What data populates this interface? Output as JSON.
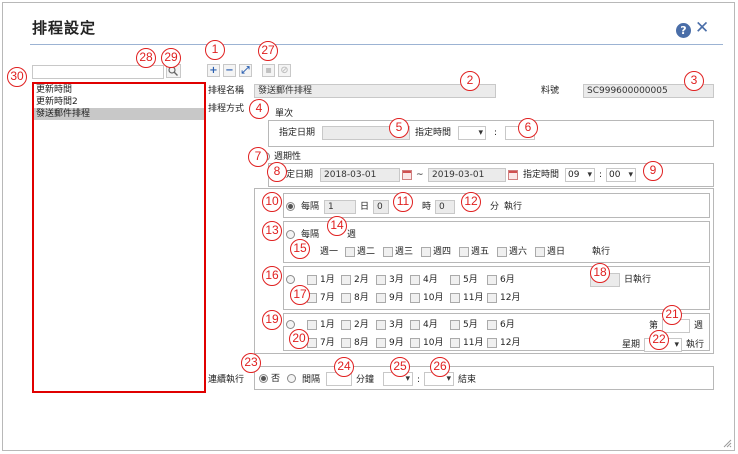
{
  "dialog": {
    "title": "排程設定",
    "help_icon": "?",
    "close_icon": "✕"
  },
  "markers": [
    "1",
    "2",
    "3",
    "4",
    "5",
    "6",
    "7",
    "8",
    "9",
    "10",
    "11",
    "12",
    "13",
    "14",
    "15",
    "16",
    "17",
    "18",
    "19",
    "20",
    "21",
    "22",
    "23",
    "24",
    "25",
    "26",
    "27",
    "28",
    "29",
    "30"
  ],
  "toolbar": {
    "add": "+",
    "remove": "−",
    "edit": "⤢",
    "save": "▪",
    "cancel": "⊘"
  },
  "tree": {
    "search_value": "",
    "items": [
      "更新時間",
      "更新時間2",
      "發送郵件排程"
    ]
  },
  "form": {
    "name_label": "排程名稱",
    "name_value": "發送郵件排程",
    "code_label": "料號",
    "code_value": "SC999600000005",
    "method_label": "排程方式",
    "once": {
      "label": "單次",
      "date_label": "指定日期",
      "date_value": "",
      "time_label": "指定時間",
      "colon": ":"
    },
    "periodic": {
      "label": "週期性",
      "date_label": "指定日期",
      "start_date": "2018-03-01",
      "tilde": "~",
      "end_date": "2019-03-01",
      "time_label": "指定時間",
      "hour": "09",
      "colon": ":",
      "minute": "00"
    },
    "every": {
      "prefix": "每隔",
      "days": "1",
      "day_unit": "日",
      "hours": "0",
      "hour_unit": "時",
      "minutes": "0",
      "minute_unit": "分",
      "run": "執行"
    },
    "weekly": {
      "prefix": "每隔",
      "week_unit": "週",
      "days": [
        "週一",
        "週二",
        "週三",
        "週四",
        "週五",
        "週六",
        "週日"
      ],
      "run": "執行"
    },
    "monthly": {
      "months_row1": [
        "1月",
        "2月",
        "3月",
        "4月",
        "5月",
        "6月"
      ],
      "months_row2": [
        "7月",
        "8月",
        "9月",
        "10月",
        "11月",
        "12月"
      ],
      "day_run": "日執行"
    },
    "monthly_week": {
      "months_row1": [
        "1月",
        "2月",
        "3月",
        "4月",
        "5月",
        "6月"
      ],
      "months_row2": [
        "7月",
        "8月",
        "9月",
        "10月",
        "11月",
        "12月"
      ],
      "nth_prefix": "第",
      "week_unit": "週",
      "weekday_label": "星期",
      "run": "執行"
    },
    "continuous": {
      "label": "連續執行",
      "no_label": "否",
      "interval_label": "間隔",
      "minute_unit": "分鐘",
      "colon": ":",
      "end_label": "結束"
    }
  }
}
